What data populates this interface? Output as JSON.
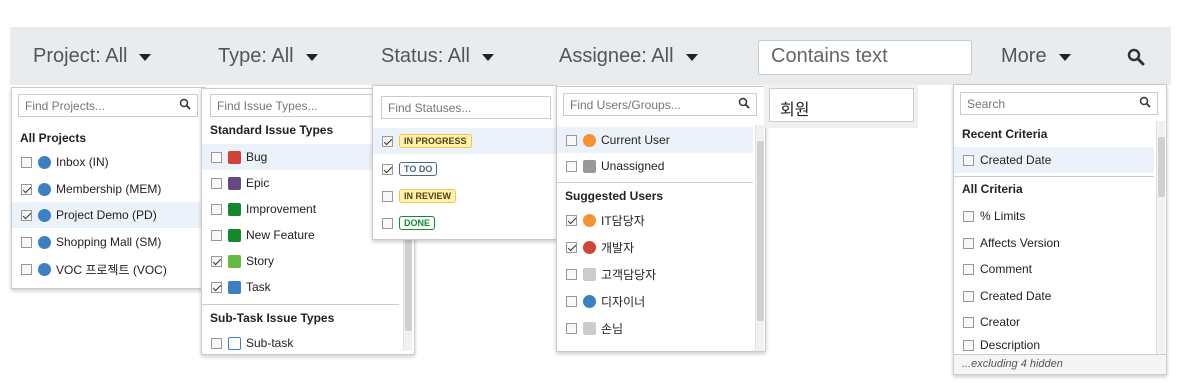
{
  "toolbar": {
    "project": "Project: All",
    "type": "Type: All",
    "status": "Status: All",
    "assignee": "Assignee: All",
    "text_placeholder": "Contains text",
    "more": "More"
  },
  "projects": {
    "search_placeholder": "Find Projects...",
    "group": "All Projects",
    "items": [
      {
        "label": "Inbox (IN)",
        "checked": false
      },
      {
        "label": "Membership (MEM)",
        "checked": true
      },
      {
        "label": "Project Demo (PD)",
        "checked": true
      },
      {
        "label": "Shopping Mall (SM)",
        "checked": false
      },
      {
        "label": "VOC 프로젝트 (VOC)",
        "checked": false
      }
    ]
  },
  "types": {
    "search_placeholder": "Find Issue Types...",
    "group_standard": "Standard Issue Types",
    "group_subtask": "Sub-Task Issue Types",
    "items": [
      {
        "label": "Bug",
        "checked": false,
        "color": "#d04437"
      },
      {
        "label": "Epic",
        "checked": false,
        "color": "#654982"
      },
      {
        "label": "Improvement",
        "checked": false,
        "color": "#3b7fc4"
      },
      {
        "label": "New Feature",
        "checked": false,
        "color": "#14892c"
      },
      {
        "label": "Story",
        "checked": true,
        "color": "#14892c"
      },
      {
        "label": "Task",
        "checked": true,
        "color": "#4a6785"
      }
    ],
    "subtask": {
      "label": "Sub-task",
      "checked": false
    }
  },
  "statuses": {
    "search_placeholder": "Find Statuses...",
    "items": [
      {
        "label": "IN PROGRESS",
        "checked": true,
        "color": "#594300",
        "bg": "#fff0b3",
        "border": "#f6c342"
      },
      {
        "label": "TO DO",
        "checked": true,
        "color": "#4a6785",
        "bg": "#fff",
        "border": "#4a6785"
      },
      {
        "label": "IN REVIEW",
        "checked": false,
        "color": "#594300",
        "bg": "#fff0b3",
        "border": "#f6c342"
      },
      {
        "label": "DONE",
        "checked": false,
        "color": "#14892c",
        "bg": "#fff",
        "border": "#14892c"
      }
    ]
  },
  "users": {
    "search_placeholder": "Find Users/Groups...",
    "items_top": [
      {
        "label": "Current User",
        "checked": false
      },
      {
        "label": "Unassigned",
        "checked": false
      }
    ],
    "group": "Suggested Users",
    "items": [
      {
        "label": "IT담당자",
        "checked": true
      },
      {
        "label": "개발자",
        "checked": true
      },
      {
        "label": "고객담당자",
        "checked": false
      },
      {
        "label": "디자이너",
        "checked": false
      },
      {
        "label": "손님",
        "checked": false
      }
    ]
  },
  "text_dropdown": {
    "value": "회원"
  },
  "more": {
    "search_placeholder": "Search",
    "group_recent": "Recent Criteria",
    "recent": [
      {
        "label": "Created Date",
        "checked": false
      }
    ],
    "group_all": "All Criteria",
    "items": [
      {
        "label": "% Limits",
        "checked": false
      },
      {
        "label": "Affects Version",
        "checked": false
      },
      {
        "label": "Comment",
        "checked": false
      },
      {
        "label": "Created Date",
        "checked": false
      },
      {
        "label": "Creator",
        "checked": false
      },
      {
        "label": "Description",
        "checked": false
      }
    ],
    "footer": "...excluding 4 hidden"
  }
}
